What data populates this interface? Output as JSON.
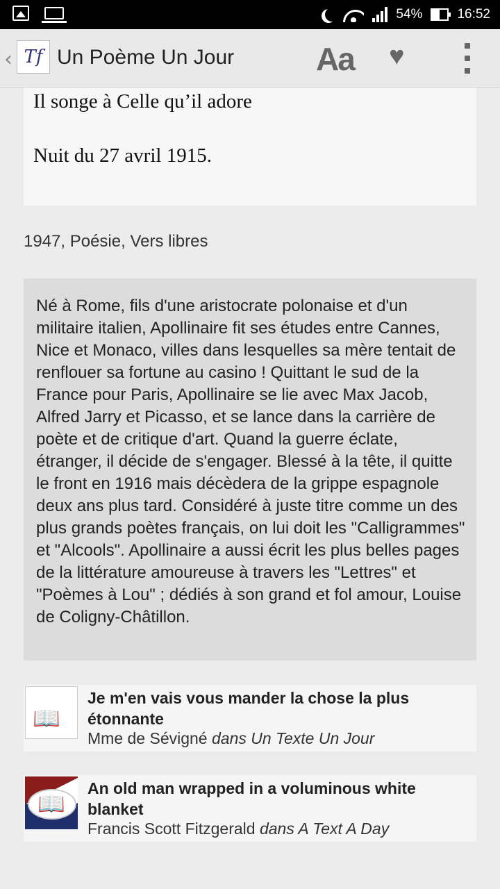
{
  "status_bar": {
    "battery_percent": "54%",
    "time": "16:52",
    "icons": [
      "gallery-icon",
      "laptop-icon",
      "moon-icon",
      "wifi-icon",
      "signal-icon",
      "battery-icon"
    ]
  },
  "app_bar": {
    "back_icon": "chevron-left-icon",
    "logo_text": "Tf",
    "title": "Un Poème Un Jour",
    "font_button_label": "Aa",
    "favorite_icon": "heart-icon",
    "menu_icon": "overflow-menu-icon"
  },
  "poem": {
    "line1": "Il songe à Celle qu’il adore",
    "line2": "Nuit du 27 avril 1915."
  },
  "meta": "1947, Poésie, Vers libres",
  "bio": "Né à Rome, fils d'une aristocrate polonaise et d'un militaire italien, Apollinaire fit ses études entre Cannes, Nice et Monaco, villes dans lesquelles sa mère tentait de renflouer sa fortune au casino ! Quittant le sud de la France pour Paris, Apollinaire se lie avec Max Jacob, Alfred Jarry et Picasso, et se lance dans la carrière de poète et de critique d'art. Quand la guerre éclate, étranger, il décide de s'engager. Blessé à la tête, il quitte le front en 1916 mais décèdera de la grippe espagnole deux ans plus tard. Considéré à juste titre comme un des plus grands poètes français, on lui doit les \"Calligrammes\" et \"Alcools\". Apollinaire a aussi écrit les plus belles pages de la littérature amoureuse à travers les \"Lettres\" et \"Poèmes à Lou\" ; dédiés à son grand et fol amour, Louise de Coligny-Châtillon.",
  "related": [
    {
      "title": "Je m'en vais vous mander la chose la plus étonnante",
      "author": "Mme de Sévigné",
      "source": "dans Un Texte Un Jour"
    },
    {
      "title": "An old man wrapped in a voluminous white blanket",
      "author": "Francis Scott Fitzgerald",
      "source": "dans A Text A Day"
    }
  ]
}
